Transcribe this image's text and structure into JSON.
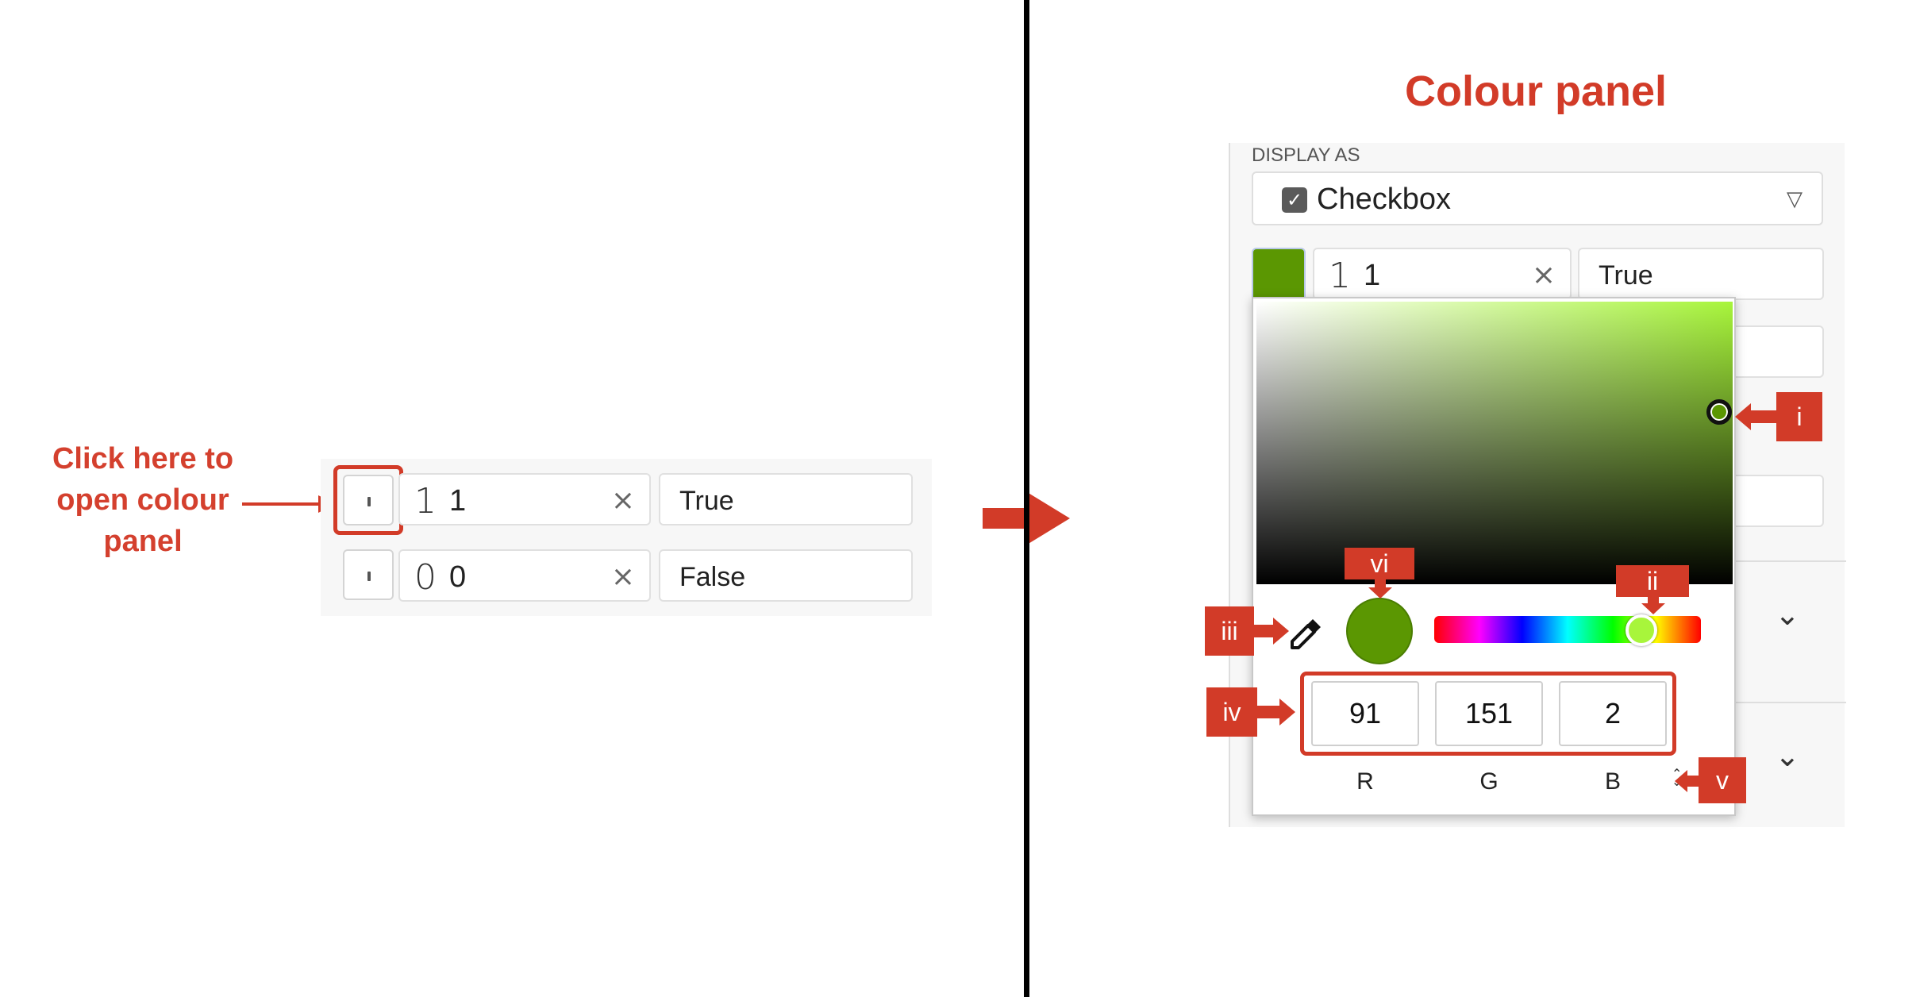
{
  "left": {
    "annotation_text_lines": [
      "Click here to",
      "open colour",
      "panel"
    ],
    "rows": [
      {
        "glyph": "1",
        "value": "1",
        "clear": "×",
        "label": "True"
      },
      {
        "glyph": "0",
        "value": "0",
        "clear": "×",
        "label": "False"
      }
    ]
  },
  "right": {
    "title": "Colour panel",
    "display_as_label": "DISPLAY AS",
    "dropdown": {
      "check": "✓",
      "text": "Checkbox",
      "caret": "▽"
    },
    "row": {
      "glyph": "1",
      "value": "1",
      "clear": "×",
      "label": "True"
    },
    "color": {
      "hex": "#5b9702",
      "hue_color": "#a8f53b"
    },
    "rgb": {
      "r": "91",
      "g": "151",
      "b": "2",
      "r_label": "R",
      "g_label": "G",
      "b_label": "B",
      "toggle": "⌃⌄"
    },
    "callouts": [
      "i",
      "ii",
      "iii",
      "iv",
      "v",
      "vi"
    ],
    "chevrons": [
      "⌄",
      "⌄"
    ]
  },
  "colors": {
    "accent_red": "#d23b28",
    "swatch_green": "#5b9702"
  }
}
